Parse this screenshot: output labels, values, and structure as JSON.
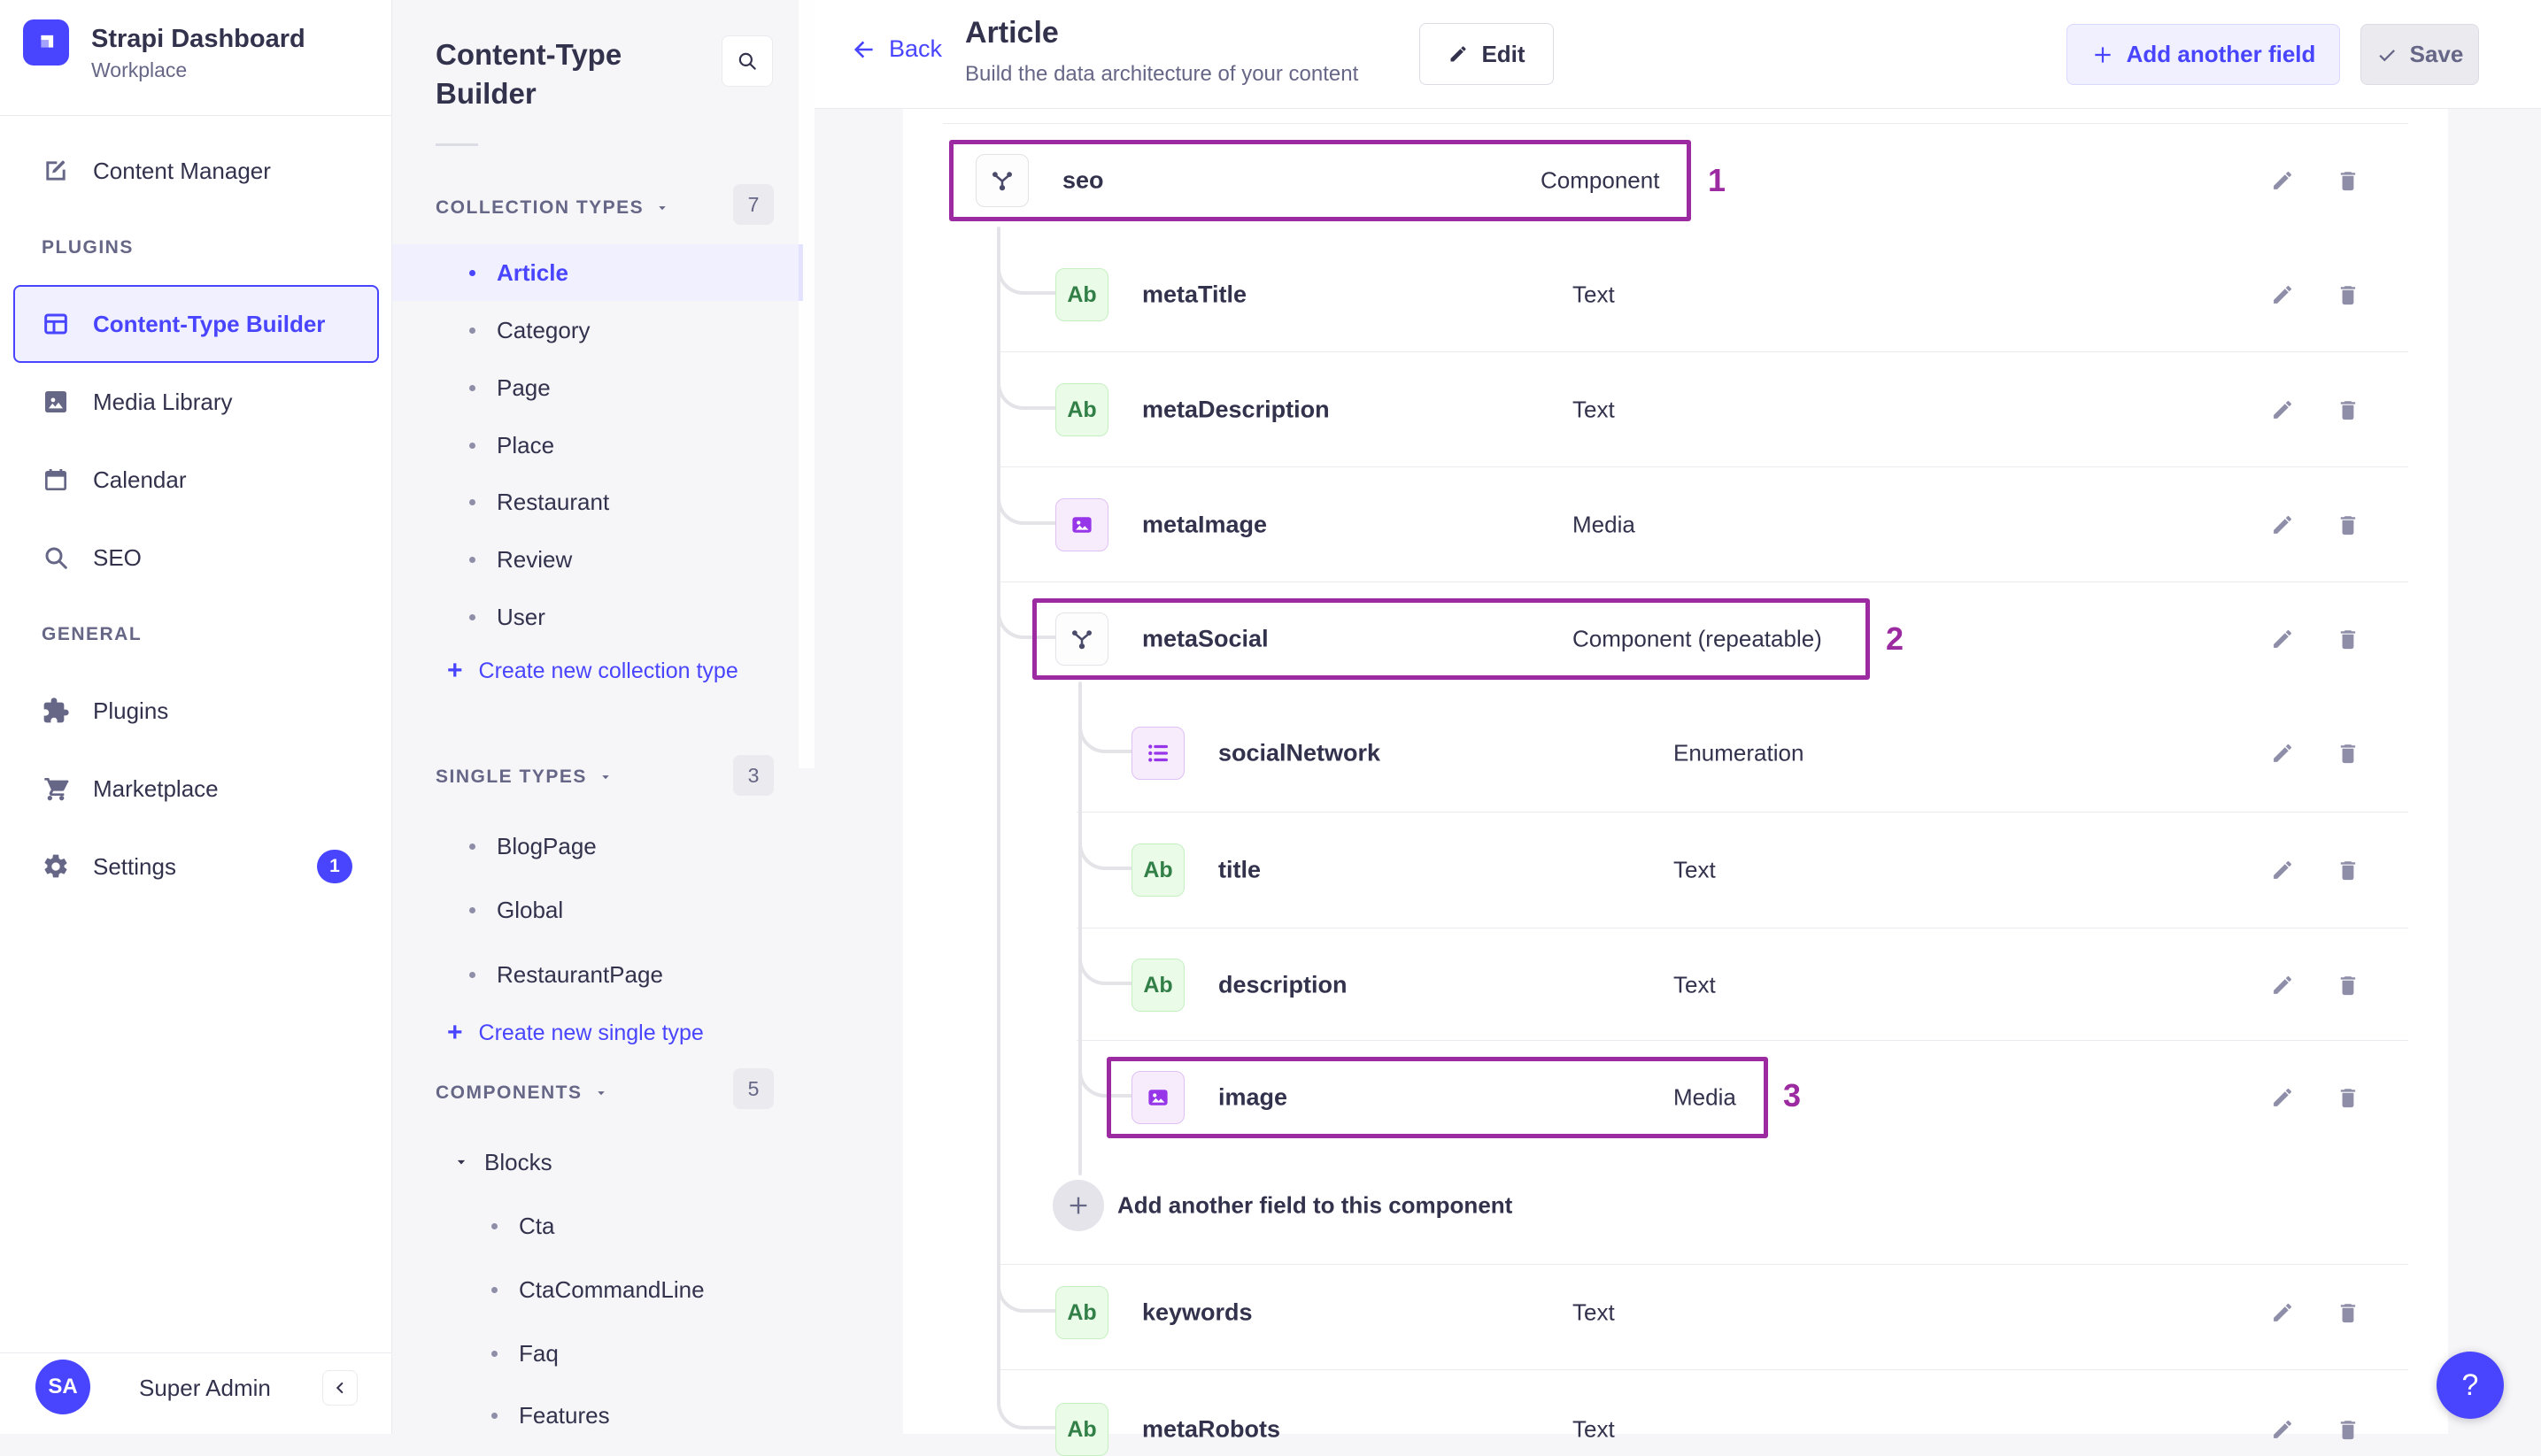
{
  "colors": {
    "accent": "#4945FF",
    "accent_bg": "#F0F0FF",
    "annotation": "#9C2AA0",
    "text_dark": "#32324D",
    "text_grey": "#666687",
    "icon_grey": "#8E8EA9",
    "chip_text_green": "#328048",
    "chip_purple": "#9736E8",
    "panel_bg": "#F6F6F9"
  },
  "app": {
    "name": "Strapi Dashboard",
    "workspace": "Workplace",
    "user_initials": "SA",
    "user_name": "Super Admin",
    "help_label": "?"
  },
  "sidebar": {
    "primary": [
      {
        "label": "Content Manager",
        "icon": "content-manager"
      }
    ],
    "sections": [
      {
        "header": "PLUGINS",
        "items": [
          {
            "label": "Content-Type Builder",
            "icon": "ctb",
            "active": true
          },
          {
            "label": "Media Library",
            "icon": "media-library"
          },
          {
            "label": "Calendar",
            "icon": "calendar"
          },
          {
            "label": "SEO",
            "icon": "search"
          }
        ]
      },
      {
        "header": "GENERAL",
        "items": [
          {
            "label": "Plugins",
            "icon": "puzzle"
          },
          {
            "label": "Marketplace",
            "icon": "cart"
          },
          {
            "label": "Settings",
            "icon": "gear",
            "badge": "1"
          }
        ]
      }
    ]
  },
  "builder_panel": {
    "title": "Content-Type Builder",
    "sections": [
      {
        "header": "COLLECTION TYPES",
        "count": "7",
        "items": [
          "Article",
          "Category",
          "Page",
          "Place",
          "Restaurant",
          "Review",
          "User"
        ],
        "active_item": "Article",
        "action": "Create new collection type"
      },
      {
        "header": "SINGLE TYPES",
        "count": "3",
        "items": [
          "BlogPage",
          "Global",
          "RestaurantPage"
        ],
        "action": "Create new single type"
      },
      {
        "header": "COMPONENTS",
        "count": "5",
        "group": {
          "label": "Blocks",
          "items": [
            "Cta",
            "CtaCommandLine",
            "Faq",
            "Features"
          ]
        }
      }
    ]
  },
  "header": {
    "back": "Back",
    "title": "Article",
    "subtitle": "Build the data architecture of your content",
    "edit": "Edit",
    "add_field": "Add another field",
    "save": "Save"
  },
  "content": {
    "text_chip_label": "Ab",
    "fields": [
      {
        "name": "seo",
        "type": "Component",
        "icon": "component",
        "level": 0,
        "highlight": "1"
      },
      {
        "name": "metaTitle",
        "type": "Text",
        "icon": "text",
        "level": 1
      },
      {
        "name": "metaDescription",
        "type": "Text",
        "icon": "text",
        "level": 1
      },
      {
        "name": "metaImage",
        "type": "Media",
        "icon": "media",
        "level": 1
      },
      {
        "name": "metaSocial",
        "type": "Component (repeatable)",
        "icon": "component",
        "level": 1,
        "highlight": "2"
      },
      {
        "name": "socialNetwork",
        "type": "Enumeration",
        "icon": "enum",
        "level": 2
      },
      {
        "name": "title",
        "type": "Text",
        "icon": "text",
        "level": 2
      },
      {
        "name": "description",
        "type": "Text",
        "icon": "text",
        "level": 2
      },
      {
        "name": "image",
        "type": "Media",
        "icon": "media",
        "level": 2,
        "highlight": "3"
      },
      {
        "action": "Add another field to this component",
        "level": 2
      },
      {
        "name": "keywords",
        "type": "Text",
        "icon": "text",
        "level": 1
      },
      {
        "name": "metaRobots",
        "type": "Text",
        "icon": "text",
        "level": 1
      }
    ]
  }
}
